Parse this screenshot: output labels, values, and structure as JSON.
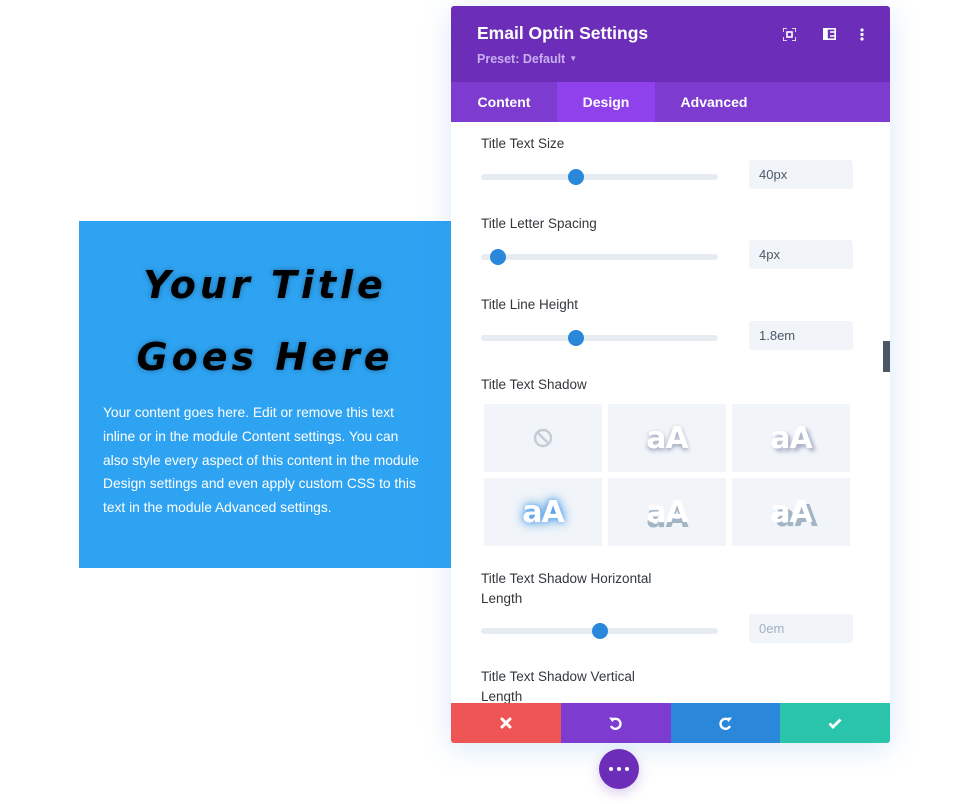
{
  "preview": {
    "title": "Your Title Goes Here",
    "body": "Your content goes here. Edit or remove this text inline or in the module Content settings. You can also style every aspect of this content in the module Design settings and even apply custom CSS to this text in the module Advanced settings.",
    "background_color": "#2ea3f2"
  },
  "panel": {
    "title": "Email Optin Settings",
    "preset_label": "Preset: Default",
    "header_icons": [
      "focus-mode-icon",
      "sidebar-layout-icon",
      "more-options-icon"
    ],
    "tabs": [
      {
        "label": "Content",
        "active": false
      },
      {
        "label": "Design",
        "active": true
      },
      {
        "label": "Advanced",
        "active": false
      }
    ],
    "fields": {
      "title_text_size": {
        "label": "Title Text Size",
        "value": "40px",
        "slider_fraction": 0.4
      },
      "title_letter_spacing": {
        "label": "Title Letter Spacing",
        "value": "4px",
        "slider_fraction": 0.07
      },
      "title_line_height": {
        "label": "Title Line Height",
        "value": "1.8em",
        "slider_fraction": 0.4
      },
      "title_text_shadow": {
        "label": "Title Text Shadow",
        "presets": [
          {
            "name": "none",
            "sample": ""
          },
          {
            "name": "shadow-bottom-soft",
            "sample": "aA"
          },
          {
            "name": "shadow-bottom-right-soft",
            "sample": "aA"
          },
          {
            "name": "shadow-glow",
            "sample": "aA"
          },
          {
            "name": "shadow-bottom-hard",
            "sample": "aA"
          },
          {
            "name": "shadow-bottom-right-hard",
            "sample": "aA"
          }
        ]
      },
      "title_text_shadow_horizontal_length": {
        "label_line1": "Title Text Shadow Horizontal",
        "label_line2": "Length",
        "value": "0em",
        "slider_fraction": 0.5
      },
      "title_text_shadow_vertical_length": {
        "label_line1": "Title Text Shadow Vertical",
        "label_line2": "Length"
      }
    }
  },
  "footer": {
    "buttons": [
      {
        "name": "cancel",
        "icon": "close-icon",
        "color": "#ef5555"
      },
      {
        "name": "undo",
        "icon": "undo-icon",
        "color": "#7e3bd0"
      },
      {
        "name": "redo",
        "icon": "redo-icon",
        "color": "#2b87da"
      },
      {
        "name": "save",
        "icon": "checkmark-icon",
        "color": "#29c4a9"
      }
    ]
  },
  "colors": {
    "header": "#6c2eb9",
    "tabs": "#7d3bcf",
    "active_tab": "#8f42ec",
    "slider_accent": "#2b87da"
  }
}
